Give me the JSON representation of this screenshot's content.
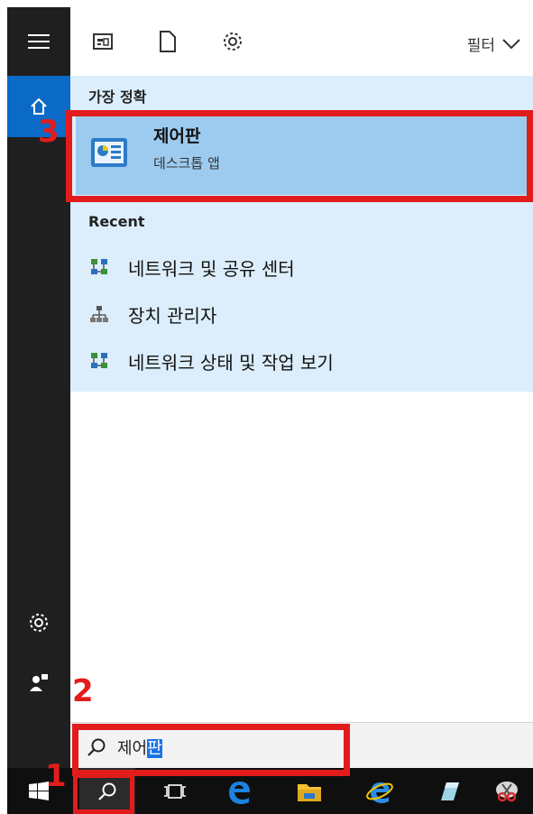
{
  "filter": {
    "label": "필터"
  },
  "results": {
    "best_match_header": "가장 정확",
    "best_match": {
      "title": "제어판",
      "subtitle": "데스크톱 앱"
    },
    "recent_header": "Recent",
    "recent_items": [
      {
        "label": "네트워크 및 공유 센터",
        "icon": "network-icon"
      },
      {
        "label": "장치 관리자",
        "icon": "device-manager-icon"
      },
      {
        "label": "네트워크 상태 및 작업 보기",
        "icon": "network-icon"
      }
    ]
  },
  "search": {
    "typed": "제어",
    "highlighted": "판"
  },
  "annotations": {
    "one": "1",
    "two": "2",
    "three": "3",
    "color": "#e21c1c"
  },
  "colors": {
    "rail": "#1f1f1f",
    "accent": "#0b6ac6",
    "results_bg": "#dceefb",
    "best_match_bg": "#9ccbef",
    "taskbar": "#0f0f0f"
  }
}
